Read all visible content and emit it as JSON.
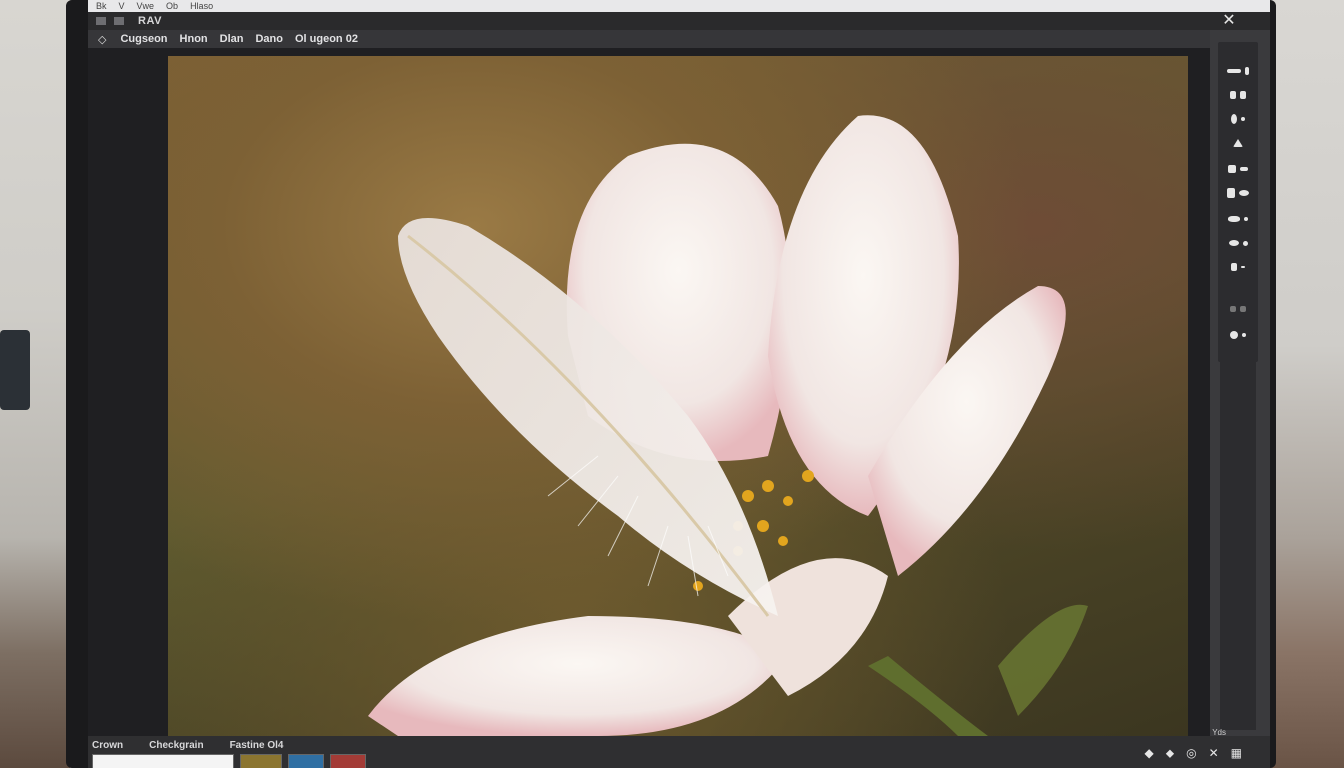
{
  "app": {
    "menu_items": [
      "Bk",
      "V",
      "Vwe",
      "Ob",
      "Hlaso"
    ],
    "window_title": "RAV"
  },
  "options_bar": {
    "items": [
      "Cugseon",
      "Hnon",
      "Dlan",
      "Dano",
      "Ol ugeon 02"
    ]
  },
  "right_panel": {
    "tools": [
      "move-icon",
      "lasso-icon",
      "brush-icon",
      "stamp-icon",
      "eraser-icon",
      "gradient-icon",
      "blur-icon",
      "dodge-icon",
      "pen-icon",
      "type-icon",
      "hand-icon"
    ]
  },
  "status_bar": {
    "labels": [
      "Crown",
      "Checkgrain",
      "Fastine Ol4"
    ],
    "right_labels": [
      "Yds"
    ],
    "thumbnails": [
      "white",
      "gold",
      "blue",
      "red"
    ]
  },
  "colors": {
    "accent": "#1e90ff",
    "panel": "#3a3a3d",
    "workspace": "#1f1f22"
  }
}
